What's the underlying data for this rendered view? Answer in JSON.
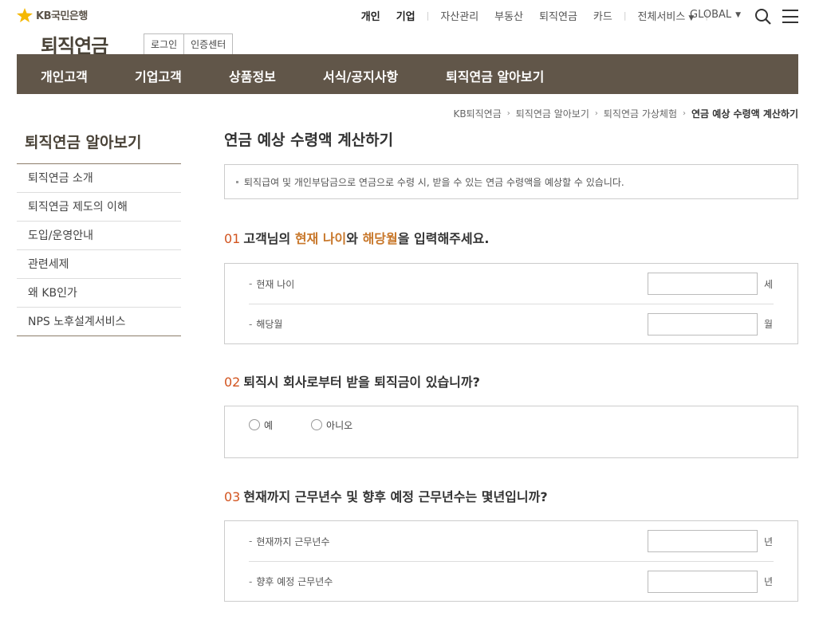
{
  "header": {
    "bank_name": "KB국민은행",
    "util_nav": [
      {
        "label": "개인",
        "strong": true
      },
      {
        "label": "기업",
        "strong": true
      },
      {
        "label": "자산관리",
        "strong": false
      },
      {
        "label": "부동산",
        "strong": false
      },
      {
        "label": "퇴직연금",
        "strong": false
      },
      {
        "label": "카드",
        "strong": false
      }
    ],
    "all_services": "전체서비스",
    "global": "GLOBAL",
    "site_title": "퇴직연금",
    "login": "로그인",
    "cert_center": "인증센터"
  },
  "gnb": [
    "개인고객",
    "기업고객",
    "상품정보",
    "서식/공지사항",
    "퇴직연금 알아보기"
  ],
  "breadcrumb": [
    "KB퇴직연금",
    "퇴직연금 알아보기",
    "퇴직연금 가상체험",
    "연금 예상 수령액 계산하기"
  ],
  "lnb": {
    "title": "퇴직연금 알아보기",
    "items": [
      "퇴직연금 소개",
      "퇴직연금 제도의 이해",
      "도입/운영안내",
      "관련세제",
      "왜 KB인가",
      "NPS 노후설계서비스"
    ]
  },
  "main": {
    "title": "연금 예상 수령액 계산하기",
    "notice": "퇴직급여 및 개인부담금으로 연금으로 수령 시, 받을 수 있는 연금 수령액을 예상할 수 있습니다.",
    "q1": {
      "num": "01",
      "t1": "고객님의 ",
      "h1": "현재 나이",
      "t2": "와 ",
      "h2": "해당월",
      "t3": "을 입력해주세요.",
      "age_label": "현재 나이",
      "age_value": "",
      "age_unit": "세",
      "month_label": "해당월",
      "month_value": "",
      "month_unit": "월"
    },
    "q2": {
      "num": "02",
      "text": "퇴직시 회사로부터 받을 퇴직금이 있습니까?",
      "yes": "예",
      "no": "아니오"
    },
    "q3": {
      "num": "03",
      "text": "현재까지 근무년수 및 향후 예정 근무년수는 몇년입니까?",
      "current_label": "현재까지 근무년수",
      "current_value": "",
      "current_unit": "년",
      "future_label": "향후 예정 근무년수",
      "future_value": "",
      "future_unit": "년"
    }
  },
  "colors": {
    "gnb_bg": "#615649",
    "accent_orange": "#d2541f",
    "highlight": "#c8772a",
    "logo_yellow": "#f5b800"
  }
}
